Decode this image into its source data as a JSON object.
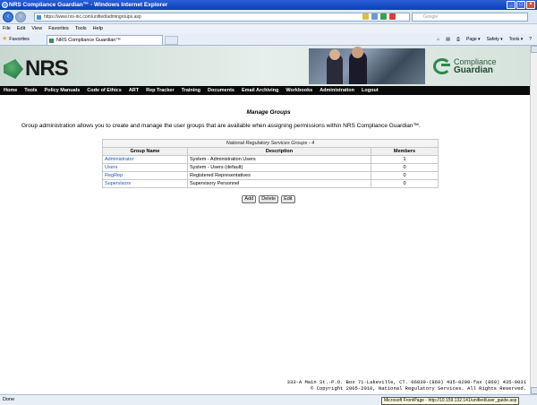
{
  "window": {
    "title": "NRS Compliance Guardian™ - Windows Internet Explorer"
  },
  "address": {
    "url": "https://www.nrs-inc.com/unified/admingroups.asp",
    "search_placeholder": "Google"
  },
  "menu": [
    "File",
    "Edit",
    "View",
    "Favorites",
    "Tools",
    "Help"
  ],
  "favorites": {
    "label": "Favorites",
    "tab_title": "NRS Compliance Guardian™"
  },
  "command_bar": [
    "Page ▾",
    "Safety ▾",
    "Tools ▾"
  ],
  "banner": {
    "logo_text": "NRS",
    "product_line1": "Compliance",
    "product_line2": "Guardian"
  },
  "nav": [
    "Home",
    "Tools",
    "Policy Manuals",
    "Code of Ethics",
    "ART",
    "Rep Tracker",
    "Training",
    "Documents",
    "Email Archiving",
    "Workbooks",
    "Administration",
    "Logout"
  ],
  "page": {
    "title": "Manage Groups",
    "intro": "Group administration allows you to create and manage the user groups that are available when assigning permissions within NRS Compliance Guardian™."
  },
  "table": {
    "caption": "National Regulatory Services Groups - 4",
    "headers": [
      "Group Name",
      "Description",
      "Members"
    ],
    "rows": [
      {
        "name": "Administrator",
        "description": "System - Administration Users",
        "members": "1"
      },
      {
        "name": "Users",
        "description": "System - Users (default)",
        "members": "0"
      },
      {
        "name": "RegRep",
        "description": "Registered Representatives",
        "members": "0"
      },
      {
        "name": "Supervisors",
        "description": "Supervisory Personnel",
        "members": "0"
      }
    ]
  },
  "buttons": {
    "add": "Add",
    "delete": "Delete",
    "edit": "Edit"
  },
  "footer": {
    "line1": "333-A Main St.∙P.O. Box 71∙Lakeville, CT. 06039∙(860) 435-0200∙fax (860) 435-0031",
    "line2": "© Copyright 2005-2010, National Regulatory Services. All Rights Reserved."
  },
  "status": {
    "text": "Done",
    "tooltip": "Microsoft FrontPage - http://10.159.132.141/unified/user_guide.asp"
  }
}
